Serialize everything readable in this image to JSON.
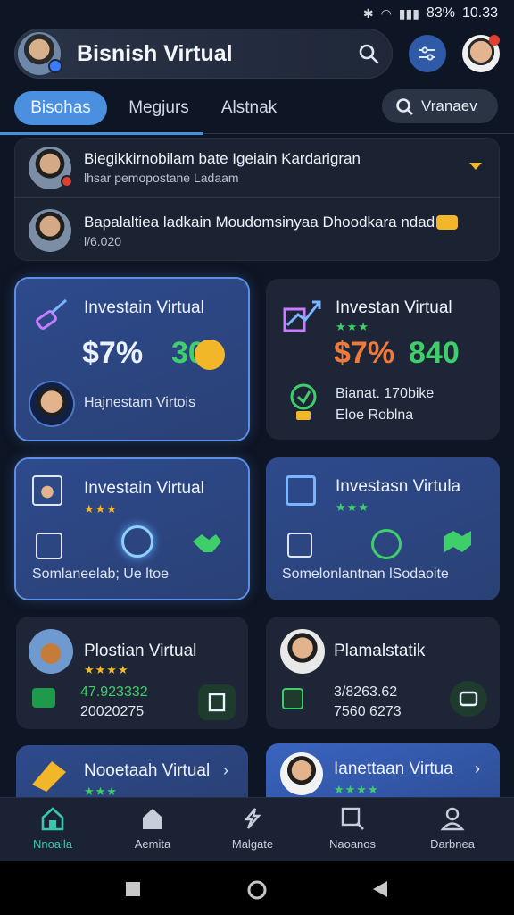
{
  "status": {
    "battery": "83%",
    "time": "10.33"
  },
  "app": {
    "title": "Bisnish Virtual"
  },
  "tabs": [
    {
      "label": "Bisohas"
    },
    {
      "label": "Megjurs"
    },
    {
      "label": "Alstnak"
    }
  ],
  "filter": {
    "label": "Vranaev"
  },
  "notifications": [
    {
      "title": "Biegikkirnobilam bate Igeiain Kardarigran",
      "subtitle": "lhsar pemopostane Ladaam"
    },
    {
      "title": "Bapalaltiea ladkain Moudomsinyaa Dhoodkara ndad",
      "subtitle": "l/6.020"
    }
  ],
  "cards": [
    {
      "title": "Investain Virtual",
      "value_a": "$7%",
      "value_b": "30",
      "caption": "Hajnestam Virtois"
    },
    {
      "title": "Investan Virtual",
      "value_a": "$7%",
      "value_b": "840",
      "caption_1": "Bianat. 170bike",
      "caption_2": "Eloe Roblna",
      "stars": "★★★"
    },
    {
      "title": "Investain Virtual",
      "stars": "★★★",
      "caption": "Somlaneelab; Ue ltoe"
    },
    {
      "title": "Investasn Virtula",
      "stars": "★★★",
      "caption": "Somelonlantnan lSodaoite"
    },
    {
      "title": "Plostian Virtual",
      "stars": "★★★★",
      "line_1": "47.923332",
      "line_2": "20020275"
    },
    {
      "title": "Plamalstatik",
      "line_1": "3/8263.62",
      "line_2": "7560 6273"
    },
    {
      "title": "Nooetaah Virtual",
      "stars": "★★★"
    },
    {
      "title": "Ianettaan Virtua",
      "stars": "★★★★"
    }
  ],
  "nav": [
    {
      "label": "Nnoalla"
    },
    {
      "label": "Aemita"
    },
    {
      "label": "Malgate"
    },
    {
      "label": "Naoanos"
    },
    {
      "label": "Darbnea"
    }
  ],
  "colors": {
    "accent": "#4a8fe0",
    "green": "#3ecf6a",
    "orange": "#f07a3a",
    "gold": "#f2b629",
    "teal": "#38c7b0"
  }
}
